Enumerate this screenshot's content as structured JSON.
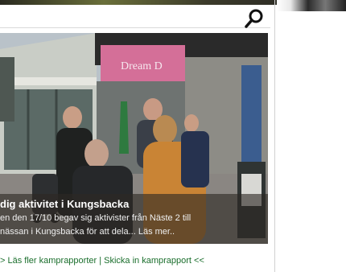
{
  "search": {
    "icon": "search-icon"
  },
  "article": {
    "title": "dig aktivitet i Kungsbacka",
    "line1": "en den 17/10 begav sig aktivister från Näste 2 till",
    "line2": "nässan i Kungsbacka för att dela...",
    "more": "Läs mer.."
  },
  "footer": {
    "prefix": ">",
    "link1": "Läs fler kamprapporter",
    "separator": "|",
    "link2": "Skicka in kamprapport",
    "suffix": "<<"
  },
  "photo": {
    "shop_sign": "Dream D"
  },
  "colors": {
    "link_green": "#1a6e2c",
    "caption_overlay": "rgba(45,40,35,0.62)"
  }
}
